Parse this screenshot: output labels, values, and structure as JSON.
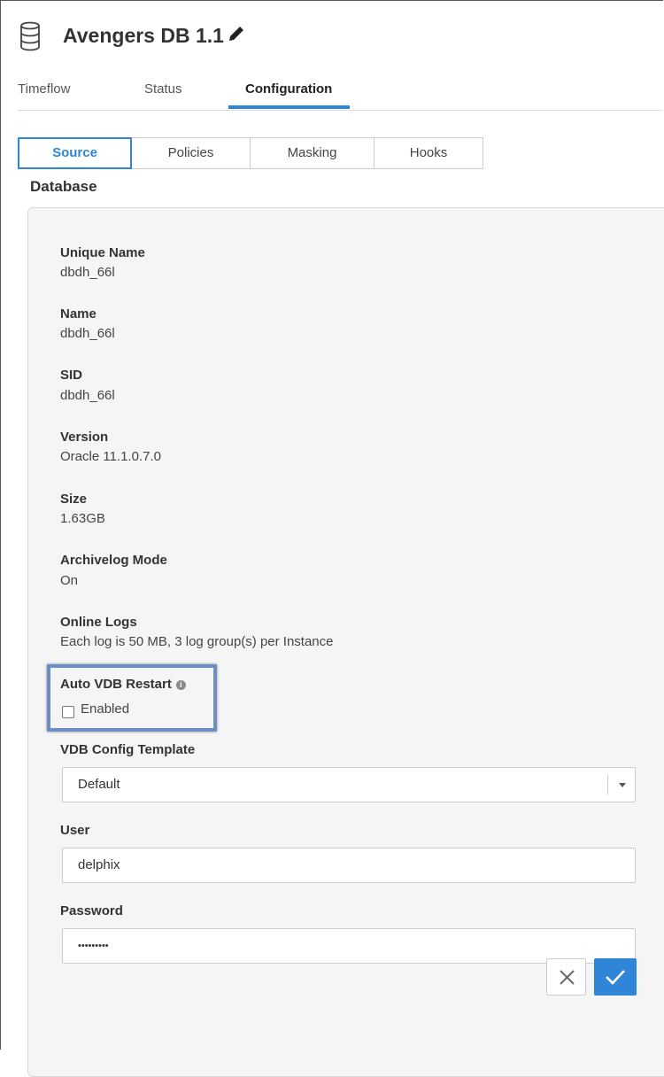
{
  "header": {
    "title": "Avengers DB 1.1",
    "icons": {
      "database": "database-icon",
      "edit": "pencil-icon"
    }
  },
  "main_tabs": [
    {
      "label": "Timeflow",
      "active": false
    },
    {
      "label": "Status",
      "active": false
    },
    {
      "label": "Configuration",
      "active": true
    }
  ],
  "sub_tabs": [
    {
      "label": "Source",
      "active": true
    },
    {
      "label": "Policies",
      "active": false
    },
    {
      "label": "Masking",
      "active": false
    },
    {
      "label": "Hooks",
      "active": false
    }
  ],
  "section_label": "Database",
  "fields": [
    {
      "label": "Unique Name",
      "value": "dbdh_66l"
    },
    {
      "label": "Name",
      "value": "dbdh_66l"
    },
    {
      "label": "SID",
      "value": "dbdh_66l"
    },
    {
      "label": "Version",
      "value": "Oracle 11.1.0.7.0"
    },
    {
      "label": "Size",
      "value": "1.63GB"
    },
    {
      "label": "Archivelog Mode",
      "value": "On"
    },
    {
      "label": "Online Logs",
      "value": "Each log is 50 MB, 3 log group(s) per Instance"
    }
  ],
  "auto_restart": {
    "label": "Auto VDB Restart",
    "info_icon": "info-icon",
    "checkbox_label": "Enabled",
    "checked": false
  },
  "config_template": {
    "label": "VDB Config Template",
    "value": "Default"
  },
  "user": {
    "label": "User",
    "value": "delphix"
  },
  "password": {
    "label": "Password",
    "value": "•••••••••"
  },
  "actions": {
    "cancel_icon": "close-icon",
    "confirm_icon": "check-icon"
  },
  "colors": {
    "accent": "#2f86d8",
    "highlight_border": "#6c8ec2",
    "panel_bg": "#f5f5f5"
  }
}
